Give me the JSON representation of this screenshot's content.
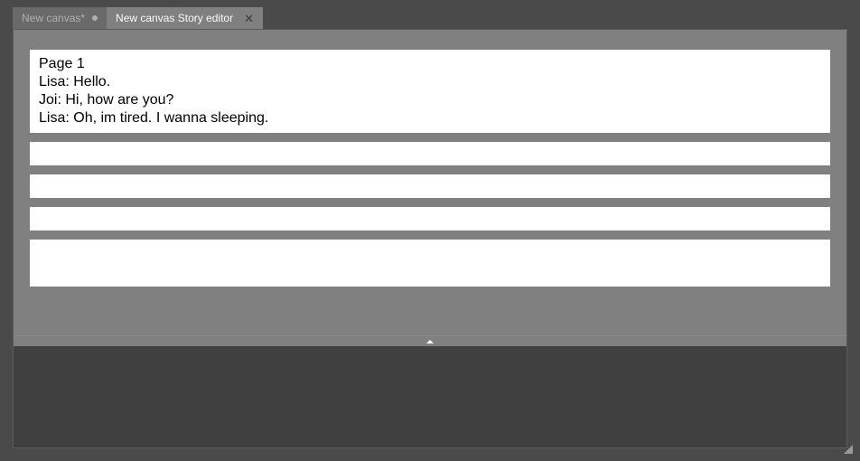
{
  "tabs": {
    "inactive": {
      "label": "New canvas*"
    },
    "active": {
      "label": "New canvas Story editor"
    }
  },
  "story": {
    "block1": {
      "line1": "Page 1",
      "line2": "Lisa: Hello.",
      "line3": "Joi: Hi, how are you?",
      "line4": "Lisa: Oh, im tired. I wanna sleeping."
    },
    "block2": "",
    "block3": "",
    "block4": "",
    "block5": ""
  }
}
